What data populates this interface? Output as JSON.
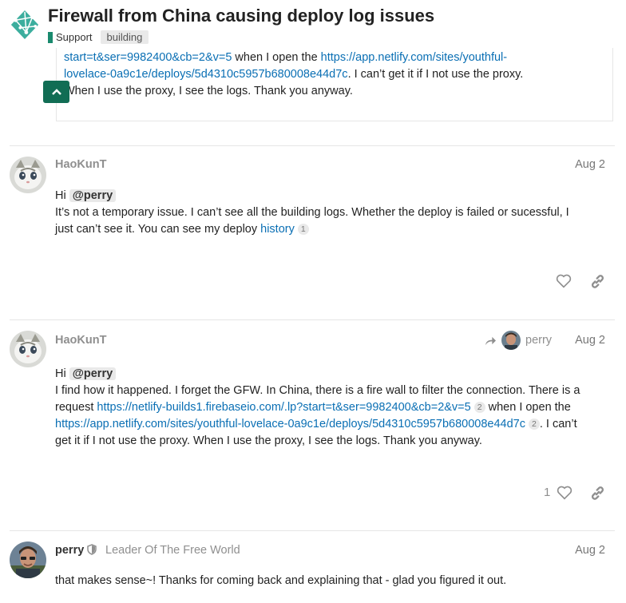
{
  "header": {
    "title": "Firewall from China causing deploy log issues",
    "category": "Support",
    "tag": "building"
  },
  "quote": {
    "link1": "start=t&ser=9982400&cb=2&v=5",
    "text1": " when I open the ",
    "link2a": "https://app.netlify.com/sites/youthful-",
    "link2b": "lovelace-0a9c1e/deploys/5d4310c5957b680008e44d7c",
    "text2": ". I can’t get it if I not use the proxy.",
    "text3": "When I use the proxy, I see the logs. Thank you anyway."
  },
  "posts": [
    {
      "username": "HaoKunT",
      "date": "Aug 2",
      "greeting": "Hi ",
      "mention": "@perry",
      "line1": "It’s not a temporary issue. I can’t see all the building logs. Whether the deploy is failed or sucessful, I",
      "line2": "just can’t see it. You can see my deploy ",
      "link": "history",
      "link_count": "1"
    },
    {
      "username": "HaoKunT",
      "date": "Aug 2",
      "reply_to": "perry",
      "greeting": "Hi ",
      "mention": "@perry",
      "line1": "I find how it happened. I forget the GFW. In China, there is a fire wall to filter the connection. There is a",
      "line2_prefix": "request ",
      "link1": "https://netlify-builds1.firebaseio.com/.lp?start=t&ser=9982400&cb=2&v=5",
      "link1_count": "2",
      "line2_suffix": " when I open the",
      "link2": "https://app.netlify.com/sites/youthful-lovelace-0a9c1e/deploys/5d4310c5957b680008e44d7c",
      "link2_count": "2",
      "line3_suffix": ". I can’t",
      "line4": "get it if I not use the proxy. When I use the proxy, I see the logs. Thank you anyway.",
      "likes": "1"
    },
    {
      "username": "perry",
      "user_title": "Leader Of The Free World",
      "date": "Aug 2",
      "line1": "that makes sense~! Thanks for coming back and explaining that - glad you figured it out."
    }
  ],
  "colors": {
    "link": "#0a6fb4",
    "brand": "#116d54",
    "category": "#1a8a6e"
  }
}
